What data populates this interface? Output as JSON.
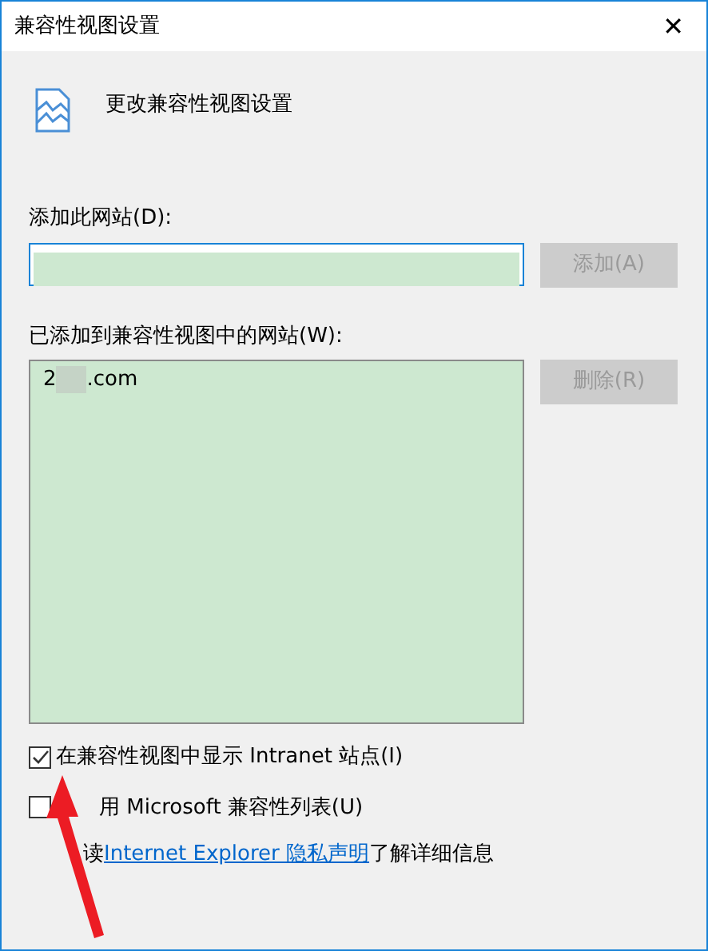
{
  "window": {
    "title": "兼容性视图设置",
    "close": "✕"
  },
  "header": "更改兼容性视图设置",
  "add_site": {
    "label": "添加此网站(D):",
    "focused": true,
    "button": {
      "label": "添加(A)",
      "disabled": true
    }
  },
  "sites": {
    "label": "已添加到兼容性视图中的网站(W):",
    "items": [
      {
        "text_start": "2",
        "redacted": true,
        "text_end": ".com"
      }
    ],
    "button": {
      "label": "删除(R)",
      "disabled": true
    }
  },
  "options": [
    {
      "label": "在兼容性视图中显示 Intranet 站点(I)",
      "checked": true
    },
    {
      "label": "用 Microsoft 兼容性列表(U)",
      "checked": false
    }
  ],
  "privacy": {
    "before": "读 ",
    "link": "Internet Explorer 隐私声明",
    "after": "了解详细信息"
  }
}
